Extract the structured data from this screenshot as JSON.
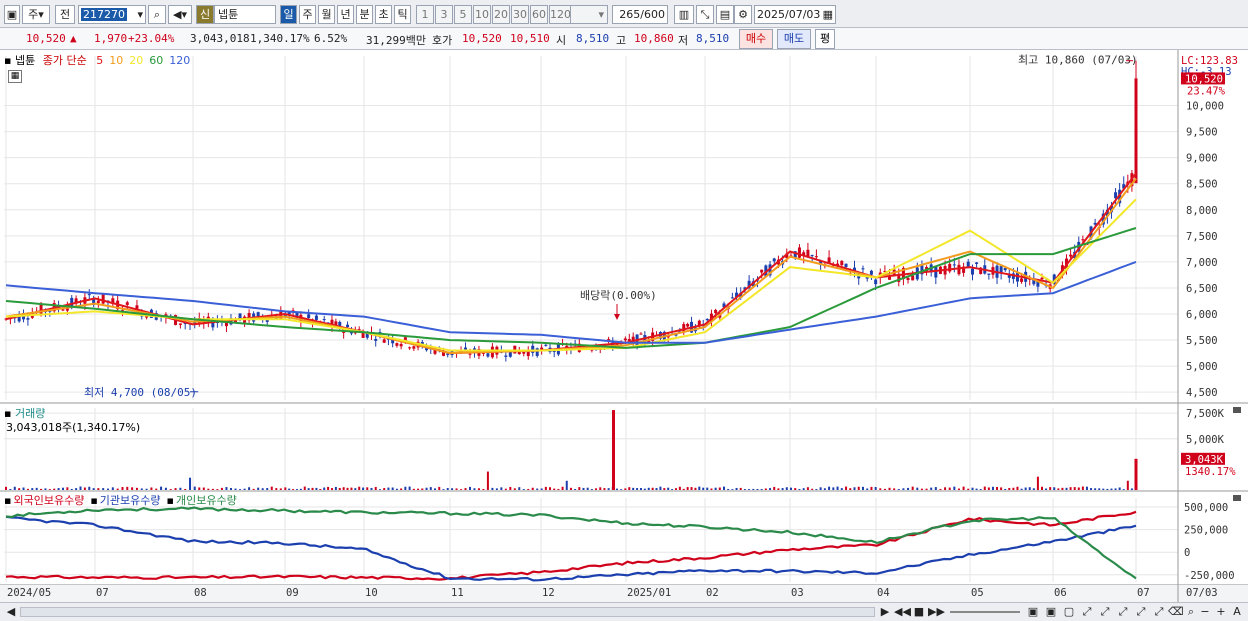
{
  "toolbar": {
    "type_label": "주",
    "prev_label": "전",
    "code": "217270",
    "sin_label": "신",
    "name": "넵튠",
    "periods": [
      "일",
      "주",
      "월",
      "년",
      "분",
      "초",
      "틱"
    ],
    "active_period": "일",
    "ticks": [
      "1",
      "3",
      "5",
      "10",
      "20",
      "30",
      "60",
      "120"
    ],
    "count": "265",
    "count_total": "/600",
    "date": "2025/07/03"
  },
  "quote": {
    "price": "10,520",
    "change": "1,970",
    "change_pct": "+23.04%",
    "volume": "3,043,018",
    "volume_pct": "1,340.17%",
    "turnover": "6.52%",
    "amount": "31,299백만",
    "bid_label": "호가",
    "bid": "10,520",
    "ask": "10,510",
    "open_label": "시",
    "open": "8,510",
    "high_label": "고",
    "high": "10,860",
    "low_label": "저",
    "low": "8,510",
    "buy_label": "매수",
    "sell_label": "매도",
    "avg_label": "평"
  },
  "price_panel": {
    "name": "넵튠",
    "legend_title": "종가 단순",
    "ma_labels": [
      "5",
      "10",
      "20",
      "60",
      "120"
    ],
    "ma_colors": [
      "#e0161c",
      "#f29b1d",
      "#f3e72a",
      "#2a9a3a",
      "#3a5fd6"
    ],
    "lc_label": "LC:123.83",
    "hc_label": "HC:-3.13",
    "current_price_label": "10,520",
    "current_pct_label": "23.47%",
    "high_annotation": "최고 10,860 (07/03)",
    "low_annotation": "최저 4,700 (08/05)",
    "dividend_annotation": "배당락(0.00%)",
    "y_ticks": [
      "10,000",
      "9,500",
      "9,000",
      "8,500",
      "8,000",
      "7,500",
      "7,000",
      "6,500",
      "6,000",
      "5,500",
      "5,000",
      "4,500"
    ]
  },
  "volume_panel": {
    "title": "거래량",
    "value_label": "3,043,018주(1,340.17%)",
    "y_ticks": [
      "7,500K",
      "5,000K"
    ],
    "current_label": "3,043K",
    "current_pct": "1340.17%"
  },
  "holder_panel": {
    "legend": [
      "외국인보유수량",
      "기관보유수량",
      "개인보유수량"
    ],
    "legend_colors": [
      "#d0021b",
      "#1b3fae",
      "#2a8a4a"
    ],
    "y_ticks": [
      "500,000",
      "250,000",
      "0",
      "-250,000"
    ]
  },
  "x_axis": {
    "labels": [
      "2024/05",
      "07",
      "08",
      "09",
      "10",
      "11",
      "12",
      "2025/01",
      "02",
      "03",
      "04",
      "05",
      "06",
      "07"
    ],
    "right_label": "07/03"
  },
  "chart_data": {
    "type": "line",
    "x": [
      "2024/05",
      "07",
      "08",
      "09",
      "10",
      "11",
      "12",
      "2025/01",
      "02",
      "03",
      "04",
      "05",
      "06",
      "07"
    ],
    "series": [
      {
        "name": "5",
        "values": [
          5900,
          6300,
          5800,
          6000,
          5650,
          5250,
          5300,
          5450,
          5800,
          7200,
          6700,
          6900,
          6600,
          8700
        ]
      },
      {
        "name": "10",
        "values": [
          5950,
          6200,
          5850,
          5950,
          5650,
          5250,
          5300,
          5400,
          5750,
          7100,
          6700,
          7200,
          6500,
          8600
        ]
      },
      {
        "name": "20",
        "values": [
          5950,
          6050,
          5900,
          5900,
          5650,
          5300,
          5300,
          5350,
          5650,
          6900,
          6700,
          7600,
          6600,
          8200
        ]
      },
      {
        "name": "60",
        "values": [
          6250,
          6100,
          5900,
          5750,
          5650,
          5500,
          5450,
          5350,
          5450,
          5750,
          6500,
          7150,
          7150,
          7650
        ]
      },
      {
        "name": "120",
        "values": [
          6550,
          6400,
          6250,
          6050,
          5950,
          5650,
          5600,
          5450,
          5450,
          5700,
          5950,
          6300,
          6400,
          7000
        ]
      }
    ],
    "ylim": [
      4500,
      10860
    ],
    "high": 10860,
    "low": 4700,
    "last": 10520
  }
}
